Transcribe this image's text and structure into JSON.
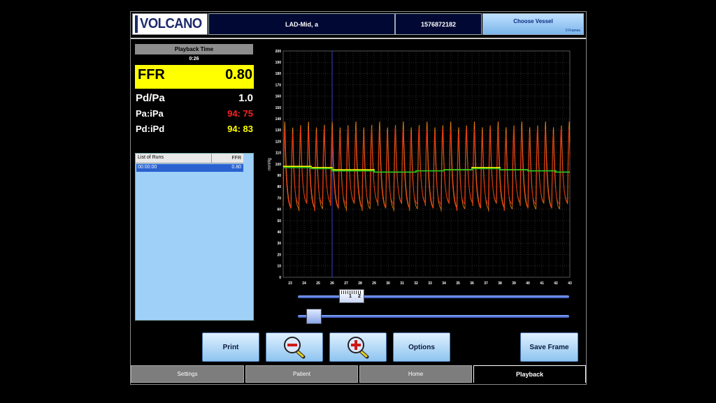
{
  "header": {
    "logo_text": "VOLCANO",
    "vessel": "LAD-Mid, a",
    "patient_id": "1576872182",
    "choose_vessel_label": "Choose Vessel",
    "frames_label": "0 Frames"
  },
  "left_panel": {
    "playback_time_label": "Playback Time",
    "playback_time_value": "0:26",
    "ffr_label": "FFR",
    "ffr_value": "0.80",
    "pdpa_label": "Pd/Pa",
    "pdpa_value": "1.0",
    "paipa_label": "Pa:iPa",
    "paipa_value": "94: 75",
    "pdipd_label": "Pd:iPd",
    "pdipd_value": "94: 83",
    "runs_header": "List of Runs",
    "runs_ffr_header": "FFR",
    "runs": [
      {
        "time": "00:00:00",
        "ffr": "0.80"
      }
    ]
  },
  "chart_data": {
    "type": "line",
    "xlabel": "",
    "ylabel": "mmHg",
    "ylim": [
      0,
      200
    ],
    "xlim": [
      22.5,
      43
    ],
    "x_ticks": [
      "23",
      "24",
      "25",
      "26",
      "27",
      "28",
      "29",
      "30",
      "31",
      "32",
      "33",
      "34",
      "35",
      "36",
      "37",
      "38",
      "39",
      "40",
      "41",
      "42",
      "43"
    ],
    "y_ticks": [
      "0",
      "10",
      "20",
      "30",
      "40",
      "50",
      "60",
      "70",
      "80",
      "90",
      "100",
      "110",
      "120",
      "130",
      "140",
      "150",
      "160",
      "170",
      "180",
      "190",
      "200"
    ],
    "grid": true,
    "cursor_x": 26.0,
    "series": [
      {
        "kind": "phasic_pa",
        "beat_period": 0.565,
        "systolic": 135,
        "diastolic": 60,
        "color": "#e07a10"
      },
      {
        "kind": "phasic_pd",
        "beat_period": 0.565,
        "systolic": 130,
        "diastolic": 62,
        "color": "#e03010"
      },
      {
        "kind": "mean_pa",
        "x": [
          22.5,
          24.5,
          26,
          29,
          32,
          34,
          36,
          38,
          40,
          42,
          43
        ],
        "y": [
          98,
          97,
          95,
          93,
          94,
          95,
          97,
          95,
          94,
          93,
          93
        ],
        "color": "#ffff00"
      },
      {
        "kind": "mean_pd",
        "x": [
          22.5,
          24.5,
          26,
          29,
          32,
          34,
          36,
          38,
          40,
          42,
          43
        ],
        "y": [
          97,
          96,
          94,
          93,
          94,
          95,
          96,
          95,
          94,
          93,
          93
        ],
        "color": "#20c020"
      }
    ],
    "colors": {
      "pa": "#e07a10",
      "pd": "#e03010",
      "mean_pa": "#ffff00",
      "mean_pd": "#20c020",
      "cursor": "#4040c0"
    }
  },
  "sliders": {
    "ruler_labels": [
      "1",
      "2"
    ],
    "scroll_position": 0.18,
    "zoom_position": 0.06
  },
  "buttons": {
    "print": "Print",
    "zoom_out_icon": "zoom-out-icon",
    "zoom_in_icon": "zoom-in-icon",
    "options": "Options",
    "save_frame": "Save Frame"
  },
  "tabs": {
    "settings": "Settings",
    "patient": "Patient",
    "home": "Home",
    "playback": "Playback"
  }
}
